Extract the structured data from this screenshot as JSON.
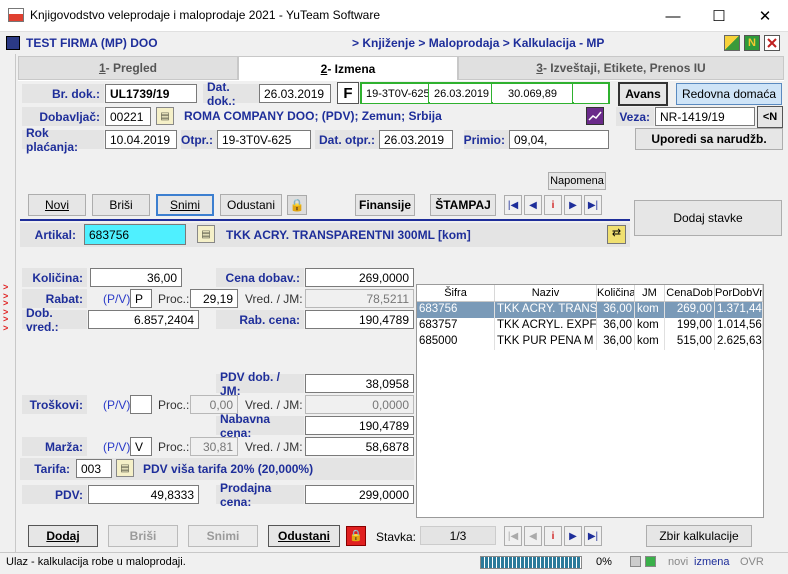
{
  "window": {
    "title": "Knjigovodstvo veleprodaje i maloprodaje 2021 - YuTeam Software",
    "min": "—",
    "max": "☐",
    "close": "✕"
  },
  "header": {
    "firm": "TEST FIRMA (MP) DOO",
    "breadcrumb": "> Knjiženje > Maloprodaja > Kalkulacija - MP"
  },
  "tabs": [
    {
      "num": "1",
      "label": " - Pregled"
    },
    {
      "num": "2",
      "label": " - Izmena"
    },
    {
      "num": "3",
      "label": " - Izveštaji, Etikete, Prenos IU"
    }
  ],
  "doc": {
    "br_dok_label": "Br. dok.:",
    "br_dok": "UL1739/19",
    "dat_dok_label": "Dat. dok.:",
    "dat_dok": "26.03.2019",
    "f_label": "F",
    "f_ref": "19-3T0V-625",
    "f_date": "26.03.2019",
    "f_amount": "30.069,89",
    "avans": "Avans",
    "redovna": "Redovna domaća",
    "dobavljac_label": "Dobavljač:",
    "dobavljac_code": "00221",
    "dobavljac_name": "ROMA COMPANY DOO; (PDV); Zemun; Srbija",
    "veza_label": "Veza:",
    "veza": "NR-1419/19",
    "veza_btn": "<N",
    "rok_label": "Rok plaćanja:",
    "rok": "10.04.2019",
    "otpr_label": "Otpr.:",
    "otpr": "19-3T0V-625",
    "dat_otpr_label": "Dat. otpr.:",
    "dat_otpr": "26.03.2019",
    "primio_label": "Primio:",
    "primio": "09,04,",
    "uporedi": "Uporedi sa narudžb."
  },
  "toolbar": {
    "napomena": "Napomena",
    "novi": "Novi",
    "brisi": "Briši",
    "snimi": "Snimi",
    "odustani": "Odustani",
    "finansije": "Finansije",
    "stampaj": "ŠTAMPAJ",
    "dodaj_stavke": "Dodaj stavke"
  },
  "artikal": {
    "label": "Artikal:",
    "code": "683756",
    "name": "TKK ACRY. TRANSPARENTNI 300ML [kom]"
  },
  "calc": {
    "kolicina_label": "Količina:",
    "kolicina": "36,00",
    "cena_dobav_label": "Cena dobav.:",
    "cena_dobav": "269,0000",
    "rabat_label": "Rabat:",
    "pv": "(P/V)",
    "rabat_pv": "P",
    "proc_label": "Proc.:",
    "rabat_proc": "29,19",
    "vred_jm_label": "Vred. / JM:",
    "rabat_vred": "78,5211",
    "dob_vred_label": "Dob. vred.:",
    "dob_vred": "6.857,2404",
    "rab_cena_label": "Rab. cena:",
    "rab_cena": "190,4789",
    "pdv_dob_label": "PDV dob. / JM:",
    "pdv_dob": "38,0958",
    "troskovi_label": "Troškovi:",
    "troskovi_pv": "",
    "troskovi_proc": "0,00",
    "troskovi_vred": "0,0000",
    "nabavna_label": "Nabavna cena:",
    "nabavna": "190,4789",
    "marza_label": "Marža:",
    "marza_pv": "V",
    "marza_proc": "30,81",
    "marza_vred": "58,6878",
    "tarifa_label": "Tarifa:",
    "tarifa_code": "003",
    "tarifa_name": "PDV viša tarifa 20% (20,000%)",
    "pdv_label": "PDV:",
    "pdv": "49,8333",
    "prodajna_label": "Prodajna cena:",
    "prodajna": "299,0000"
  },
  "grid": {
    "columns": [
      "Šifra",
      "Naziv",
      "Količina",
      "JM",
      "CenaDob",
      "PorDobVr"
    ],
    "rows": [
      [
        "683756",
        "TKK ACRY. TRANS",
        "36,00",
        "kom",
        "269,00",
        "1.371,44"
      ],
      [
        "683757",
        "TKK ACRYL. EXPF",
        "36,00",
        "kom",
        "199,00",
        "1.014,56"
      ],
      [
        "685000",
        "TKK PUR PENA M",
        "36,00",
        "kom",
        "515,00",
        "2.625,63"
      ]
    ]
  },
  "bottom": {
    "dodaj": "Dodaj",
    "brisi": "Briši",
    "snimi": "Snimi",
    "odustani": "Odustani",
    "stavka_label": "Stavka:",
    "stavka": "1/3",
    "zbir": "Zbir kalkulacije"
  },
  "status": {
    "text": "Ulaz - kalkulacija robe u maloprodaji.",
    "progress": "0%",
    "novi": "novi",
    "izmena": "izmena",
    "ovr": "OVR"
  }
}
